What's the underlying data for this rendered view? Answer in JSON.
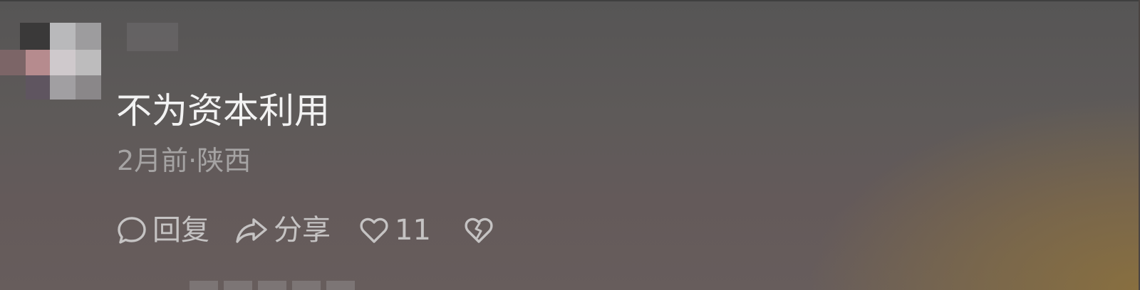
{
  "comment": {
    "text": "不为资本利用",
    "meta": "2月前·陕西"
  },
  "actions": {
    "reply_label": "回复",
    "share_label": "分享",
    "like_count": "11"
  },
  "icons": {
    "reply": "comment-bubble-icon",
    "share": "share-arrow-icon",
    "like": "heart-outline-icon",
    "dislike": "broken-heart-icon"
  },
  "colors": {
    "text_primary": "#f2f2f2",
    "text_meta": "#a5a3a3",
    "action_text": "#c5c3c3"
  }
}
